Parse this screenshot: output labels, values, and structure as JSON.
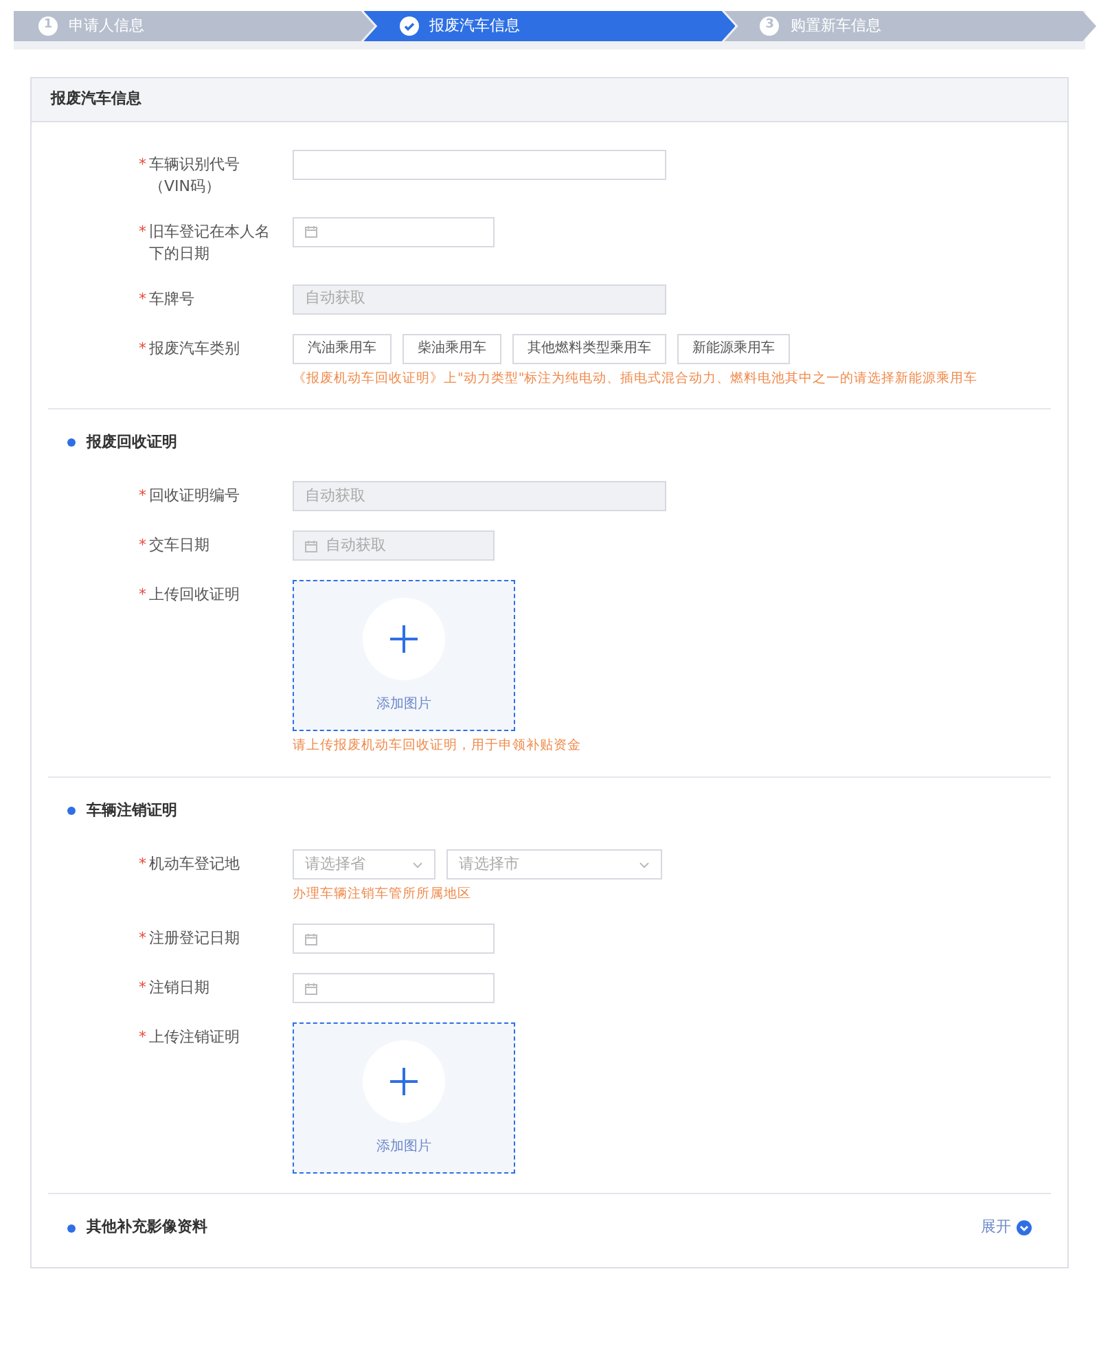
{
  "steps": [
    {
      "number": "1",
      "label": "申请人信息",
      "selected": false
    },
    {
      "label": "报废汽车信息",
      "selected": true
    },
    {
      "number": "3",
      "label": "购置新车信息",
      "selected": false
    }
  ],
  "card_title": "报废汽车信息",
  "sections": [
    {
      "fields": [
        {
          "kind": "text",
          "label": "车辆识别代号（VIN码）",
          "required": "*"
        },
        {
          "kind": "date",
          "label": "旧车登记在本人名下的日期",
          "required": "*"
        },
        {
          "kind": "text",
          "label": "车牌号",
          "required": "*",
          "placeholder": "自动获取",
          "disabled": true
        },
        {
          "kind": "options",
          "label": "报废汽车类别",
          "required": "*",
          "options": [
            "汽油乘用车",
            "柴油乘用车",
            "其他燃料类型乘用车",
            "新能源乘用车"
          ],
          "hint": "《报废机动车回收证明》上\"动力类型\"标注为纯电动、插电式混合动力、燃料电池其中之一的请选择新能源乘用车"
        }
      ]
    },
    {
      "title": "报废回收证明",
      "fields": [
        {
          "kind": "text",
          "label": "回收证明编号",
          "required": "*",
          "placeholder": "自动获取",
          "disabled": true
        },
        {
          "kind": "date",
          "label": "交车日期",
          "required": "*",
          "placeholder": "自动获取",
          "disabled": true
        },
        {
          "kind": "upload",
          "label": "上传回收证明",
          "required": "*",
          "button": "添加图片",
          "hint": "请上传报废机动车回收证明，用于申领补贴资金"
        }
      ]
    },
    {
      "title": "车辆注销证明",
      "fields": [
        {
          "kind": "selects",
          "label": "机动车登记地",
          "required": "*",
          "selects": [
            "请选择省",
            "请选择市"
          ],
          "hint": "办理车辆注销车管所所属地区"
        },
        {
          "kind": "date",
          "label": "注册登记日期",
          "required": "*"
        },
        {
          "kind": "date",
          "label": "注销日期",
          "required": "*"
        },
        {
          "kind": "upload",
          "label": "上传注销证明",
          "required": "*",
          "button": "添加图片"
        }
      ]
    },
    {
      "title": "其他补充影像资料",
      "toggle": "展开",
      "expanded": false
    }
  ]
}
